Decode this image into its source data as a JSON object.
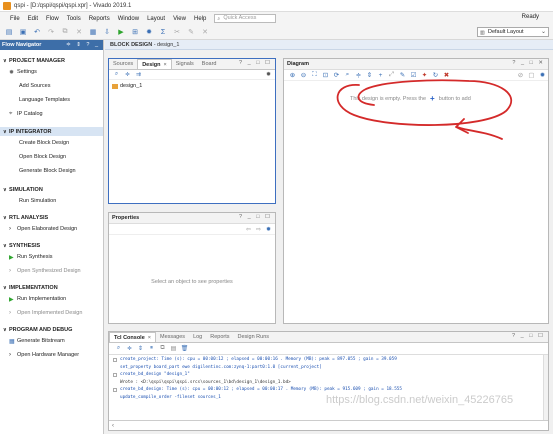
{
  "window": {
    "title": "qspi - [D:/qspi/qspi/qspi.xpr] - Vivado 2019.1"
  },
  "menu": {
    "items": [
      "File",
      "Edit",
      "Flow",
      "Tools",
      "Reports",
      "Window",
      "Layout",
      "View",
      "Help"
    ],
    "quick_access_placeholder": "Quick Access",
    "status": "Ready"
  },
  "toolbar": {
    "layout_value": "Default Layout"
  },
  "flow_navigator": {
    "title": "Flow Navigator",
    "controls": "≑ ⇕ ? _",
    "sections": [
      {
        "label": "PROJECT MANAGER",
        "items": [
          "Settings",
          "Add Sources",
          "Language Templates",
          "IP Catalog"
        ]
      },
      {
        "label": "IP INTEGRATOR",
        "items": [
          "Create Block Design",
          "Open Block Design",
          "Generate Block Design"
        ]
      },
      {
        "label": "SIMULATION",
        "items": [
          "Run Simulation"
        ]
      },
      {
        "label": "RTL ANALYSIS",
        "items": [
          "Open Elaborated Design"
        ]
      },
      {
        "label": "SYNTHESIS",
        "items": [
          "Run Synthesis",
          "Open Synthesized Design"
        ]
      },
      {
        "label": "IMPLEMENTATION",
        "items": [
          "Run Implementation",
          "Open Implemented Design"
        ]
      },
      {
        "label": "PROGRAM AND DEBUG",
        "items": [
          "Generate Bitstream",
          "Open Hardware Manager"
        ]
      }
    ]
  },
  "block_design": {
    "header_prefix": "BLOCK DESIGN",
    "name": " - design_1"
  },
  "sources": {
    "tabs": [
      "Sources",
      "Design",
      "Signals",
      "Board"
    ],
    "tree_item": "design_1",
    "win_controls": "? _ □ ☐"
  },
  "properties": {
    "title": "Properties",
    "win_controls": "? _ □ ☐",
    "empty_message": "Select an object to see properties"
  },
  "diagram": {
    "title": "Diagram",
    "win_controls": "? _ □ ✕",
    "empty_before": "This design is empty. Press the",
    "empty_after": "button to add"
  },
  "tcl_console": {
    "tabs": [
      "Tcl Console",
      "Messages",
      "Log",
      "Reports",
      "Design Runs"
    ],
    "win_controls": "? _ □ ☐",
    "lines": [
      {
        "kind": "cmd",
        "text": "create_project: Time (s): cpu = 00:00:12 ; elapsed = 00:00:16 . Memory (MB): peak = 897.055 ; gain = 39.059"
      },
      {
        "kind": "cmd",
        "text": "set_property board_part ewe digilentinc.com:zynq-1:part0:1.0 [current_project]"
      },
      {
        "kind": "cmd",
        "text": "create_bd_design \"design_1\""
      },
      {
        "kind": "out",
        "text": "Wrote  : <D:\\qspi\\qspi\\qspi.srcs\\sources_1\\bd\\design_1\\design_1.bd>"
      },
      {
        "kind": "cmd",
        "text": "create_bd_design: Time (s): cpu = 00:00:12 ; elapsed = 00:00:17 . Memory (MB): peak = 915.609 ; gain = 18.555"
      },
      {
        "kind": "out",
        "text": "update_compile_order -fileset sources_1"
      }
    ],
    "watermark": "https://blog.csdn.net/weixin_45226765"
  }
}
